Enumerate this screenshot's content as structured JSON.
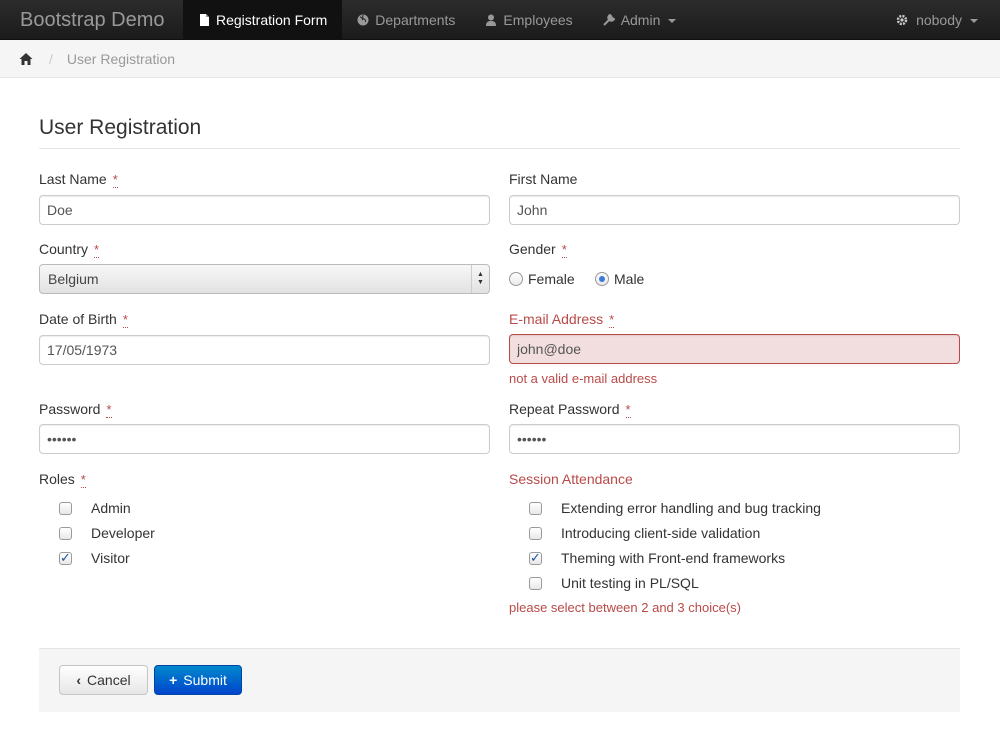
{
  "navbar": {
    "brand": "Bootstrap Demo",
    "items": [
      {
        "label": "Registration Form",
        "icon": "file-icon",
        "active": true
      },
      {
        "label": "Departments",
        "icon": "globe-icon"
      },
      {
        "label": "Employees",
        "icon": "user-icon"
      },
      {
        "label": "Admin",
        "icon": "wrench-icon"
      }
    ],
    "user": "nobody"
  },
  "breadcrumb": {
    "divider": "/",
    "current": "User Registration"
  },
  "page": {
    "title": "User Registration"
  },
  "form": {
    "required_mark": "*",
    "last_name": {
      "label": "Last Name",
      "value": "Doe"
    },
    "first_name": {
      "label": "First Name",
      "value": "John"
    },
    "country": {
      "label": "Country",
      "value": "Belgium"
    },
    "gender": {
      "label": "Gender",
      "options": [
        "Female",
        "Male"
      ],
      "selected": "Male"
    },
    "dob": {
      "label": "Date of Birth",
      "value": "17/05/1973"
    },
    "email": {
      "label": "E-mail Address",
      "value": "john@doe",
      "error": "not a valid e-mail address"
    },
    "password": {
      "label": "Password",
      "value": "••••••"
    },
    "repeat_password": {
      "label": "Repeat Password",
      "value": "••••••"
    },
    "roles": {
      "label": "Roles",
      "items": [
        {
          "label": "Admin",
          "checked": false
        },
        {
          "label": "Developer",
          "checked": false
        },
        {
          "label": "Visitor",
          "checked": true
        }
      ]
    },
    "sessions": {
      "label": "Session Attendance",
      "items": [
        {
          "label": "Extending error handling and bug tracking",
          "checked": false
        },
        {
          "label": "Introducing client-side validation",
          "checked": false
        },
        {
          "label": "Theming with Front-end frameworks",
          "checked": true
        },
        {
          "label": "Unit testing in PL/SQL",
          "checked": false
        }
      ],
      "error": "please select between 2 and 3 choice(s)"
    }
  },
  "actions": {
    "cancel": "Cancel",
    "submit": "Submit"
  },
  "colors": {
    "error": "#b94a48",
    "primary": "#0044cc",
    "navbar": "#1b1b1b"
  }
}
